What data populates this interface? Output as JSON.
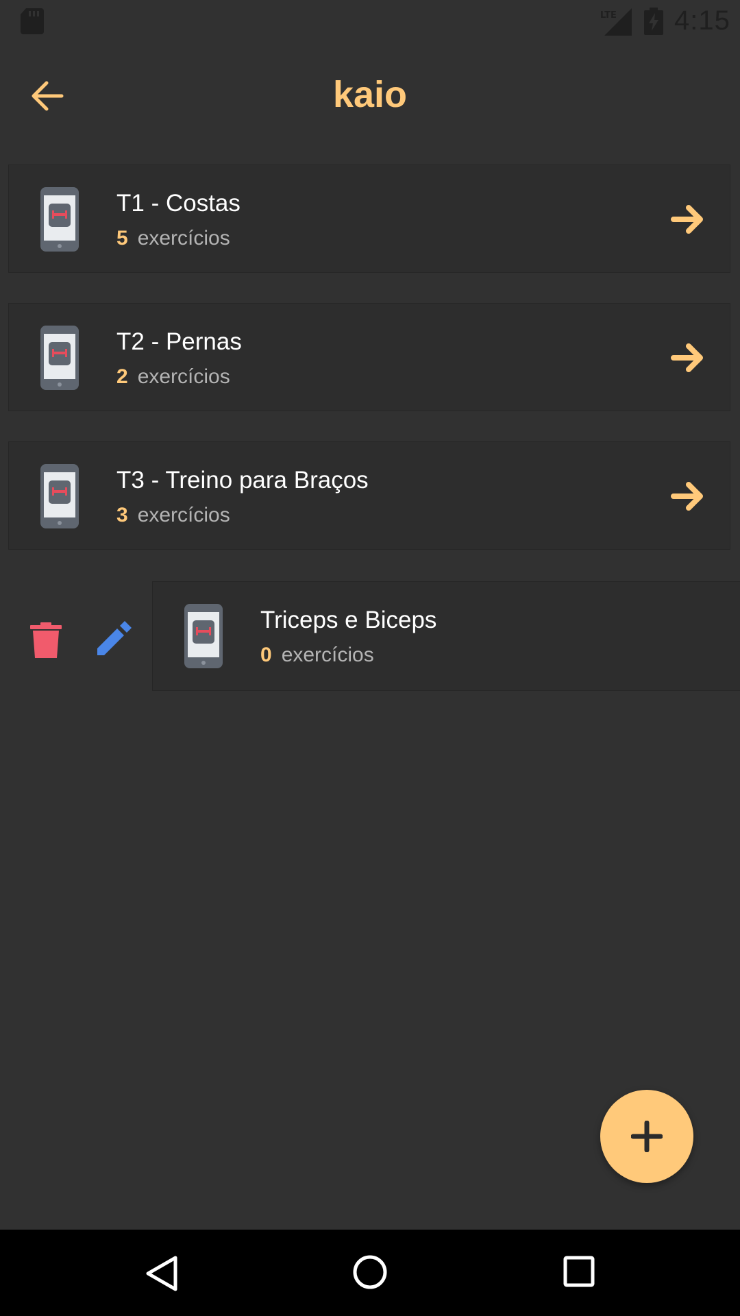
{
  "status_bar": {
    "time": "4:15",
    "network": "LTE",
    "icons": [
      "sd-card-icon",
      "lte-signal-icon",
      "battery-charging-icon"
    ]
  },
  "app_bar": {
    "title": "kaio",
    "back_icon": "arrow-left-icon"
  },
  "workouts": [
    {
      "name": "T1 - Costas",
      "count": "5",
      "count_label": "exercícios"
    },
    {
      "name": "T2 - Pernas",
      "count": "2",
      "count_label": "exercícios"
    },
    {
      "name": "T3 - Treino para Braços",
      "count": "3",
      "count_label": "exercícios"
    }
  ],
  "swiped_workout": {
    "name": "Triceps e Biceps",
    "count": "0",
    "count_label": "exercícios",
    "actions": [
      "trash-icon",
      "pencil-icon"
    ]
  },
  "fab": {
    "icon": "plus-icon"
  },
  "nav_bar": {
    "icons": [
      "nav-back-icon",
      "nav-home-icon",
      "nav-recents-icon"
    ]
  },
  "colors": {
    "background": "#313131",
    "accent": "#FFC97A",
    "delete": "#F15B6C",
    "edit": "#4A86E8",
    "text_primary": "#FFFFFF",
    "text_secondary": "#B4B4B4"
  }
}
